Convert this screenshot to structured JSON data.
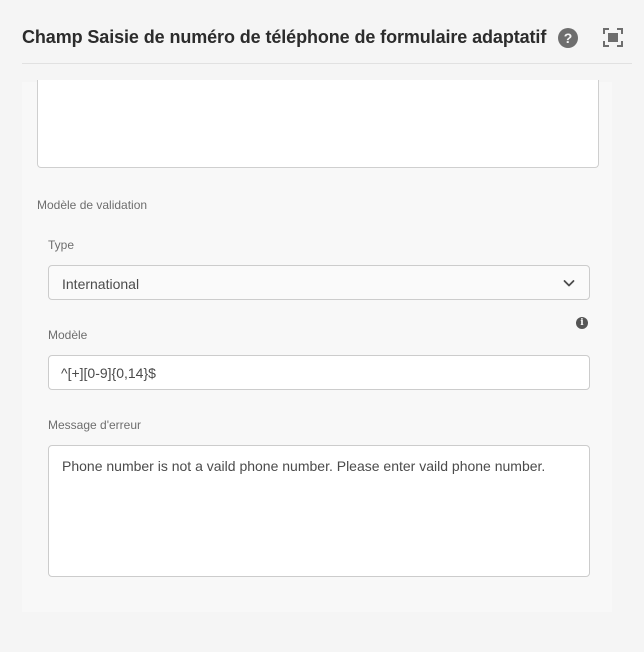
{
  "header": {
    "title": "Champ Saisie de numéro de téléphone de formulaire adaptatif",
    "help_icon_label": "?"
  },
  "validation": {
    "section_label": "Modèle de validation",
    "type_label": "Type",
    "type_value": "International",
    "pattern_label": "Modèle",
    "pattern_value": "^[+][0-9]{0,14}$",
    "info_icon_label": "i",
    "error_label": "Message d'erreur",
    "error_value": "Phone number is not a vaild phone number. Please enter vaild phone number."
  },
  "colors": {
    "background": "#f5f5f5",
    "text": "#4b4b4b",
    "title": "#2c2c2c",
    "border": "#cccccc"
  },
  "icons": [
    "help-icon",
    "fullscreen-icon",
    "chevron-down-icon",
    "info-icon"
  ]
}
